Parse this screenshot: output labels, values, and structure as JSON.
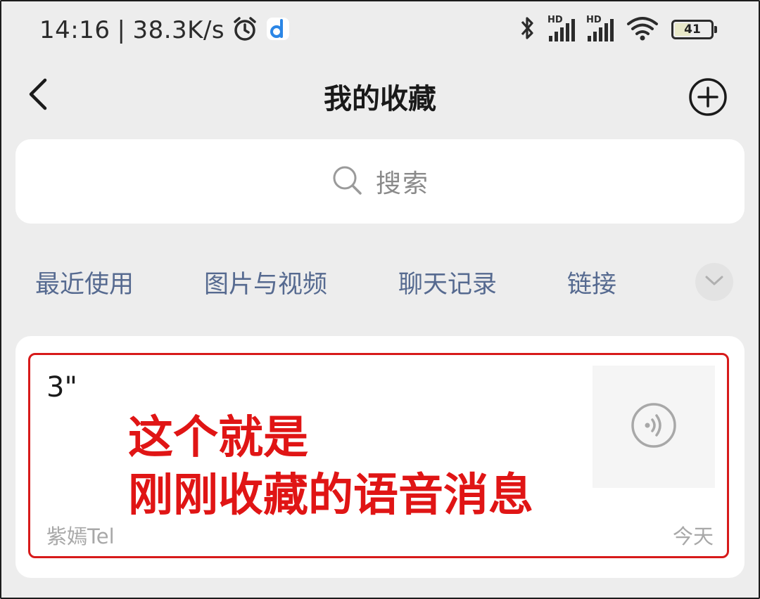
{
  "status_bar": {
    "time": "14:16",
    "separator": "|",
    "network_speed": "38.3K/s",
    "battery_level": "41",
    "battery_fraction": 0.41,
    "icons": [
      "alarm-icon",
      "app-d-icon",
      "bluetooth-icon",
      "hd-signal-icon",
      "hd-signal-icon",
      "wifi-icon",
      "battery-icon"
    ],
    "hd_label": "HD"
  },
  "header": {
    "title": "我的收藏",
    "back_icon": "chevron-left-icon",
    "add_icon": "plus-circle-icon"
  },
  "search": {
    "placeholder": "搜索",
    "icon": "search-icon"
  },
  "filter_tabs": {
    "items": [
      {
        "label": "最近使用"
      },
      {
        "label": "图片与视频"
      },
      {
        "label": "聊天记录"
      },
      {
        "label": "链接"
      }
    ],
    "expand_icon": "chevron-down-icon"
  },
  "favorites": {
    "items": [
      {
        "duration": "3\"",
        "annotation_line1": "这个就是",
        "annotation_line2": "刚刚收藏的语音消息",
        "source": "紫嫣Tel",
        "date": "今天",
        "type_icon": "voice-icon"
      }
    ]
  },
  "colors": {
    "background": "#ededed",
    "tab_text": "#566a90",
    "annotation_red": "#e01515"
  }
}
